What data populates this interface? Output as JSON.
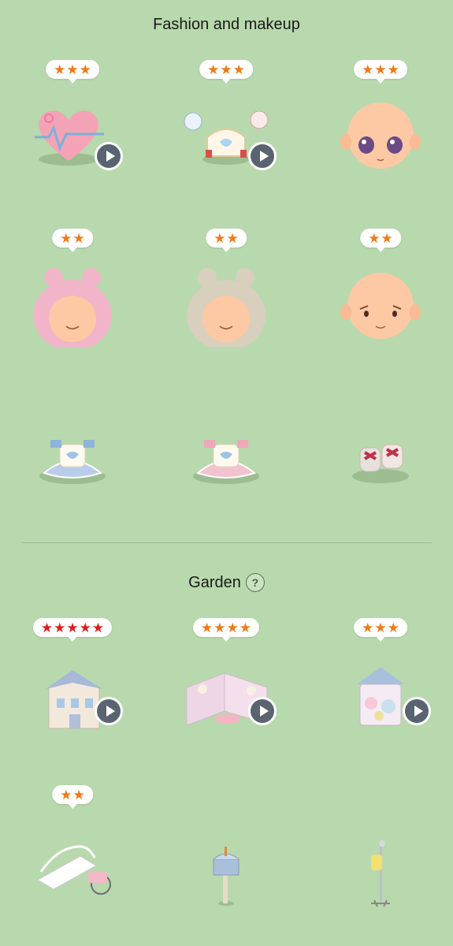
{
  "sections": {
    "fashion": {
      "title": "Fashion and makeup",
      "items": [
        {
          "name": "heart-ekg-accessory",
          "stars": 3,
          "star_color": "#f07a16",
          "video": true
        },
        {
          "name": "tiara-headpiece",
          "stars": 3,
          "star_color": "#f07a16",
          "video": true
        },
        {
          "name": "purple-eyes-face",
          "stars": 3,
          "star_color": "#f07a16",
          "video": false
        },
        {
          "name": "pink-wavy-hair",
          "stars": 2,
          "star_color": "#f07a16",
          "video": false
        },
        {
          "name": "beige-wavy-hair",
          "stars": 2,
          "star_color": "#f07a16",
          "video": false
        },
        {
          "name": "sad-face",
          "stars": 2,
          "star_color": "#f07a16",
          "video": false
        },
        {
          "name": "blue-apron-dress",
          "stars": 0,
          "video": false
        },
        {
          "name": "pink-apron-dress",
          "stars": 0,
          "video": false
        },
        {
          "name": "pink-bow-shoes",
          "stars": 0,
          "video": false
        }
      ]
    },
    "garden": {
      "title": "Garden",
      "help_label": "?",
      "items": [
        {
          "name": "blue-house",
          "stars": 5,
          "star_color": "#e01c1c",
          "video": true
        },
        {
          "name": "pink-wall-room",
          "stars": 4,
          "star_color": "#f07a16",
          "video": true
        },
        {
          "name": "gazebo-kiosk",
          "stars": 3,
          "star_color": "#f07a16",
          "video": true
        },
        {
          "name": "bench-wheelchair",
          "stars": 2,
          "star_color": "#f07a16",
          "video": false
        },
        {
          "name": "blue-mailbox",
          "stars": 0,
          "video": false
        },
        {
          "name": "iv-stand",
          "stars": 0,
          "video": false
        }
      ]
    }
  },
  "icons": {
    "star": "star-icon",
    "play": "play-icon",
    "help": "question-icon"
  },
  "colors": {
    "background": "#b8d9ad",
    "badge": "#ffffff",
    "play_button": "#5a6470"
  }
}
